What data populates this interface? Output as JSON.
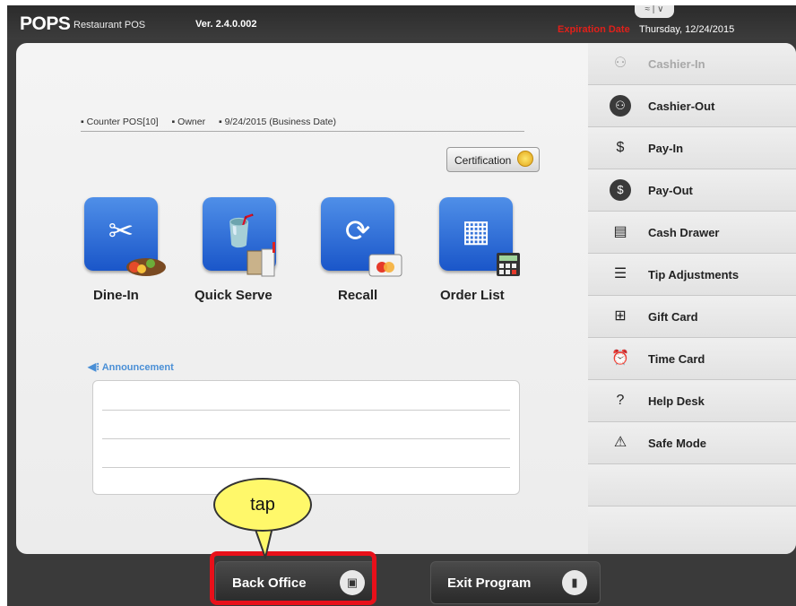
{
  "topbar": {
    "logo": "POPS",
    "logo_sub": "Restaurant POS",
    "version": "Ver. 2.4.0.002",
    "expiration_label": "Expiration Date",
    "expiration_value": "Thursday, 12/24/2015",
    "window_controls": "≈ | ∨"
  },
  "status": {
    "station": "▪ Counter POS[10]",
    "user": "▪ Owner",
    "business_date": "▪ 9/24/2015 (Business Date)"
  },
  "certification_label": "Certification",
  "tiles": [
    {
      "label": "Dine-In",
      "icon": "fork-knife-icon"
    },
    {
      "label": "Quick Serve",
      "icon": "cup-icon"
    },
    {
      "label": "Recall",
      "icon": "refresh-icon"
    },
    {
      "label": "Order List",
      "icon": "calculator-icon"
    }
  ],
  "announcement": {
    "label": "Announcement"
  },
  "sidebar": {
    "items": [
      {
        "label": "Cashier-In",
        "icon": "cashier-in-icon",
        "enabled": false
      },
      {
        "label": "Cashier-Out",
        "icon": "cashier-out-icon",
        "enabled": true
      },
      {
        "label": "Pay-In",
        "icon": "pay-in-icon",
        "enabled": true
      },
      {
        "label": "Pay-Out",
        "icon": "pay-out-icon",
        "enabled": true
      },
      {
        "label": "Cash Drawer",
        "icon": "cash-drawer-icon",
        "enabled": true
      },
      {
        "label": "Tip Adjustments",
        "icon": "tip-adjustments-icon",
        "enabled": true
      },
      {
        "label": "Gift Card",
        "icon": "gift-card-icon",
        "enabled": true
      },
      {
        "label": "Time Card",
        "icon": "alarm-clock-icon",
        "enabled": true
      },
      {
        "label": "Help Desk",
        "icon": "help-icon",
        "enabled": true
      },
      {
        "label": "Safe Mode",
        "icon": "siren-icon",
        "enabled": true
      }
    ]
  },
  "bottom": {
    "back_office": "Back Office",
    "exit_program": "Exit Program"
  },
  "callout_text": "tap",
  "colors": {
    "accent_blue": "#1a56c9",
    "expiration_red": "#e0201a",
    "highlight_red": "#e8101a",
    "callout_yellow": "#fff86a"
  }
}
